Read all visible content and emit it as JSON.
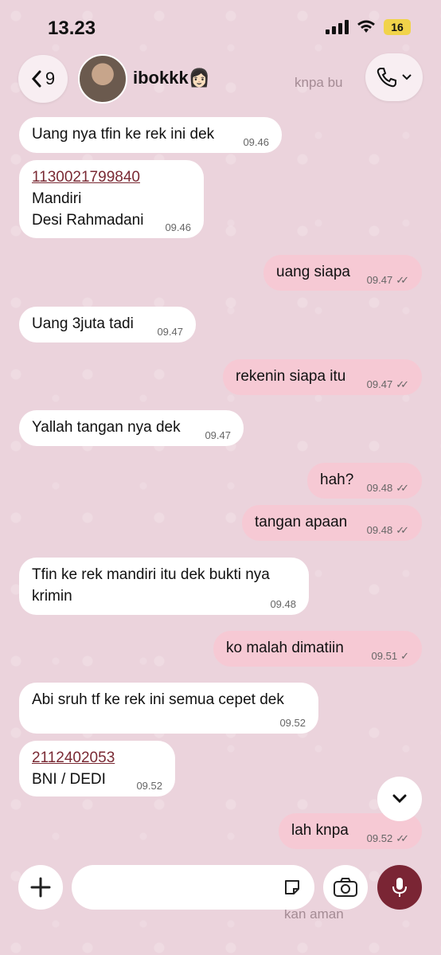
{
  "status": {
    "time": "13.23",
    "battery": "16"
  },
  "header": {
    "back_count": "9",
    "contact_name": "ibokkk👩🏻"
  },
  "messages": [
    {
      "text": "Uang nya tfin ke rek ini dek",
      "time": "09.46"
    },
    {
      "line1": "1130021799840",
      "line2": "Mandiri",
      "line3": "Desi Rahmadani",
      "time": "09.46"
    },
    {
      "text": "uang siapa",
      "time": "09.47"
    },
    {
      "text": "Uang 3juta tadi",
      "time": "09.47"
    },
    {
      "text": "rekenin siapa itu",
      "time": "09.47"
    },
    {
      "text": "Yallah tangan nya dek",
      "time": "09.47"
    },
    {
      "text": "hah?",
      "time": "09.48"
    },
    {
      "text": "tangan apaan",
      "time": "09.48"
    },
    {
      "line1": "Tfin ke rek mandiri itu dek bukti nya",
      "line2": "krimin",
      "time": "09.48"
    },
    {
      "text": "ko malah dimatiin",
      "time": "09.51"
    },
    {
      "text": "Abi sruh tf ke rek ini semua cepet dek",
      "time": "09.52"
    },
    {
      "line1": "2112402053",
      "line2": "BNI / DEDI",
      "time": "09.52"
    },
    {
      "text": "lah knpa",
      "time": "09.52"
    }
  ],
  "ghost_text": {
    "top": "knpa bu",
    "bottom": "kan aman"
  },
  "icons": [
    "chevron-left-icon",
    "phone-icon",
    "chevron-down-icon",
    "plus-icon",
    "sticker-icon",
    "camera-icon",
    "mic-icon",
    "wifi-icon",
    "signal-icon"
  ]
}
